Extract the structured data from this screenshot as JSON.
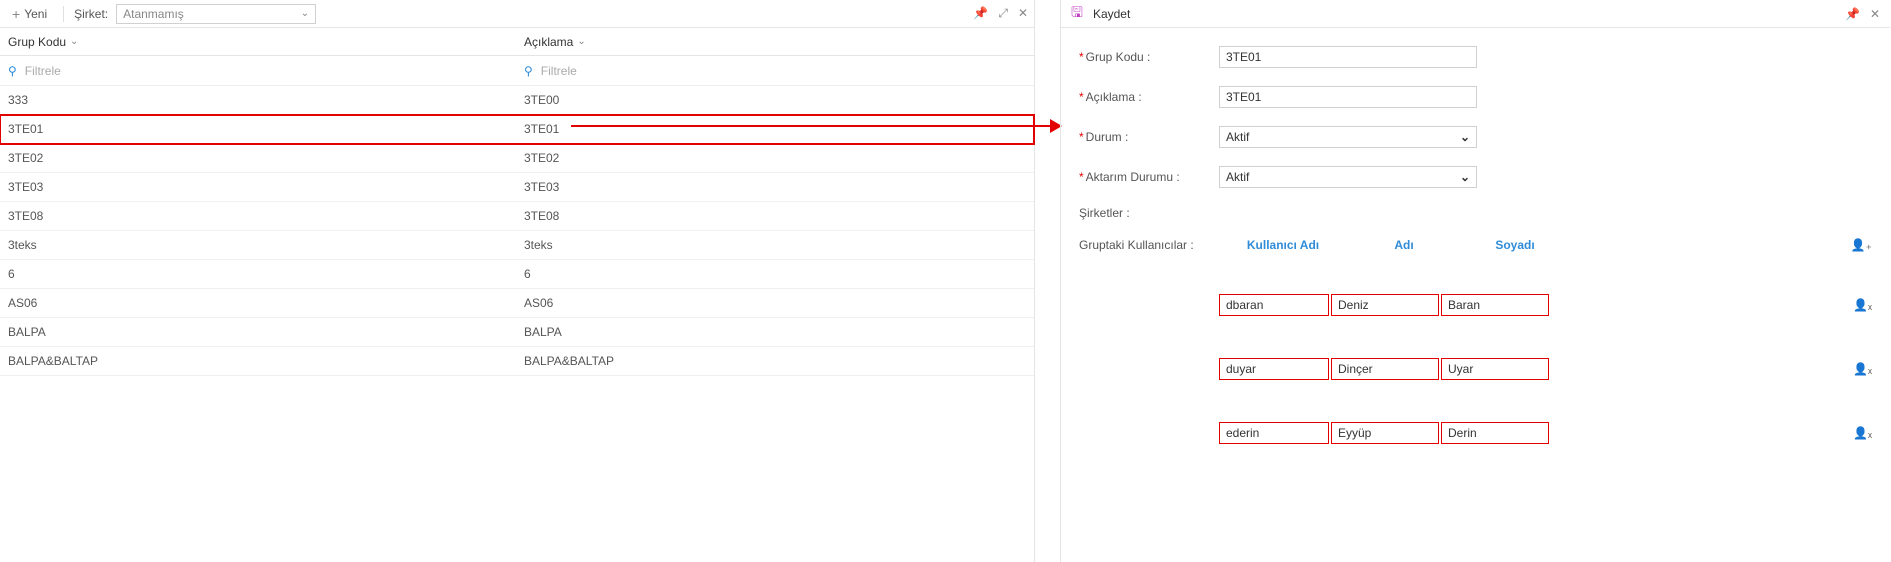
{
  "toolbar": {
    "new_label": "Yeni",
    "company_label": "Şirket:",
    "company_value": "Atanmamış"
  },
  "grid": {
    "col1_header": "Grup Kodu",
    "col2_header": "Açıklama",
    "filter_placeholder": "Filtrele",
    "rows": [
      {
        "code": "333",
        "desc": "3TE00"
      },
      {
        "code": "3TE01",
        "desc": "3TE01"
      },
      {
        "code": "3TE02",
        "desc": "3TE02"
      },
      {
        "code": "3TE03",
        "desc": "3TE03"
      },
      {
        "code": "3TE08",
        "desc": "3TE08"
      },
      {
        "code": "3teks",
        "desc": "3teks"
      },
      {
        "code": "6",
        "desc": "6"
      },
      {
        "code": "AS06",
        "desc": "AS06"
      },
      {
        "code": "BALPA",
        "desc": "BALPA"
      },
      {
        "code": "BALPA&BALTAP",
        "desc": "BALPA&BALTAP"
      }
    ]
  },
  "detail": {
    "save_label": "Kaydet",
    "grup_kodu_label": "Grup Kodu :",
    "grup_kodu_value": "3TE01",
    "aciklama_label": "Açıklama :",
    "aciklama_value": "3TE01",
    "durum_label": "Durum :",
    "durum_value": "Aktif",
    "aktarim_label": "Aktarım Durumu :",
    "aktarim_value": "Aktif",
    "sirketler_label": "Şirketler :",
    "users_label": "Gruptaki Kullanıcılar :",
    "users_col_user": "Kullanıcı Adı",
    "users_col_name": "Adı",
    "users_col_surname": "Soyadı",
    "users": [
      {
        "username": "dbaran",
        "name": "Deniz",
        "surname": "Baran"
      },
      {
        "username": "duyar",
        "name": "Dinçer",
        "surname": "Uyar"
      },
      {
        "username": "ederin",
        "name": "Eyyüp",
        "surname": "Derin"
      }
    ]
  }
}
